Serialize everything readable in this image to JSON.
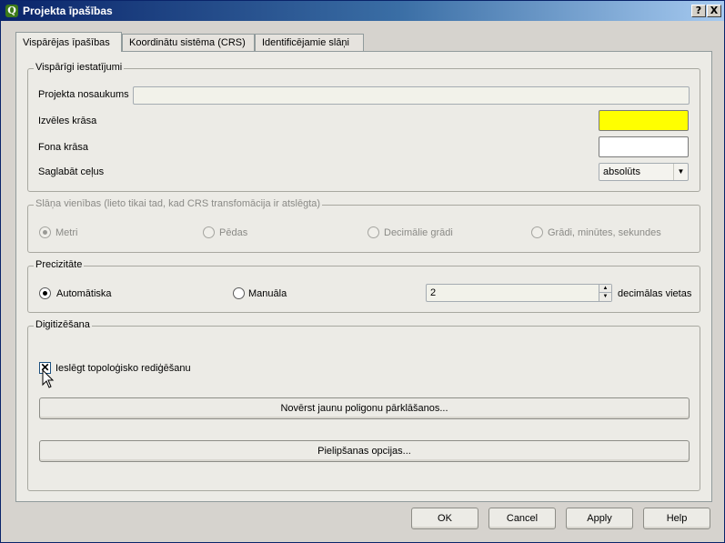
{
  "window": {
    "title": "Projekta īpašības",
    "app_icon": "Q",
    "help_glyph": "?",
    "close_glyph": "X"
  },
  "tabs": [
    {
      "label": "Vispārējas īpašības",
      "active": true
    },
    {
      "label": "Koordinātu sistēma (CRS)",
      "active": false
    },
    {
      "label": "Identificējamie slāņi",
      "active": false
    }
  ],
  "general": {
    "title": "Vispārīgi iestatījumi",
    "project_name_label": "Projekta nosaukums",
    "project_name_value": "",
    "selection_color_label": "Izvēles krāsa",
    "selection_color": "#ffff00",
    "background_color_label": "Fona krāsa",
    "background_color": "#ffffff",
    "save_paths_label": "Saglabāt ceļus",
    "save_paths_value": "absolūts"
  },
  "units": {
    "title": "Slāņa vienības (lieto tikai tad, kad CRS transfomācija ir atslēgta)",
    "enabled": false,
    "options": [
      "Metri",
      "Pēdas",
      "Decimālie grādi",
      "Grādi, minūtes, sekundes"
    ],
    "selected": "Metri"
  },
  "precision": {
    "title": "Precizitāte",
    "options": [
      "Automātiska",
      "Manuāla"
    ],
    "selected": "Automātiska",
    "decimal_value": "2",
    "decimal_suffix": "decimālas vietas"
  },
  "digitizing": {
    "title": "Digitizēšana",
    "topology_label": "Ieslēgt topoloģisko rediģēšanu",
    "topology_checked": true,
    "avoid_overlap_button": "Novērst jaunu poligonu pārklāšanos...",
    "snapping_button": "Pielipšanas opcijas..."
  },
  "footer": {
    "ok": "OK",
    "cancel": "Cancel",
    "apply": "Apply",
    "help": "Help"
  },
  "colors": {
    "titlebar_start": "#0a246a",
    "titlebar_end": "#a6caf0",
    "pane_bg": "#ecebe6"
  }
}
